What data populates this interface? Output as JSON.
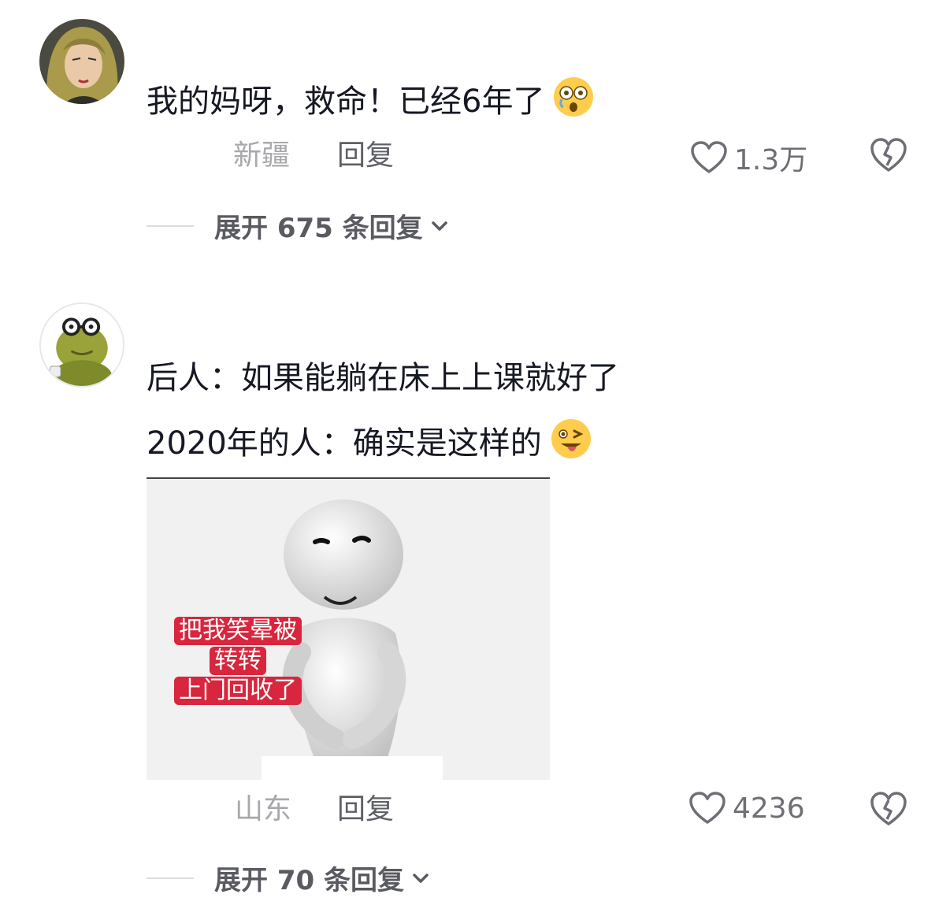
{
  "comments": [
    {
      "text": "我的妈呀，救命！已经6年了",
      "emoji": "crying-dizzy-face-emoji",
      "location": "新疆",
      "reply_label": "回复",
      "likes": "1.3万",
      "expand_label": "展开 675 条回复"
    },
    {
      "text_lines": [
        "后人：如果能躺在床上上课就好了",
        "2020年的人：确实是这样的"
      ],
      "emoji": "winking-tongue-face-emoji",
      "image_caption": [
        "把我笑晕被",
        "转转",
        "上门回收了"
      ],
      "location": "山东",
      "reply_label": "回复",
      "likes": "4236",
      "expand_label": "展开 70 条回复"
    }
  ],
  "colors": {
    "text_primary": "#161823",
    "text_secondary": "#a8a8ad",
    "caption_bg": "#d7263d"
  }
}
